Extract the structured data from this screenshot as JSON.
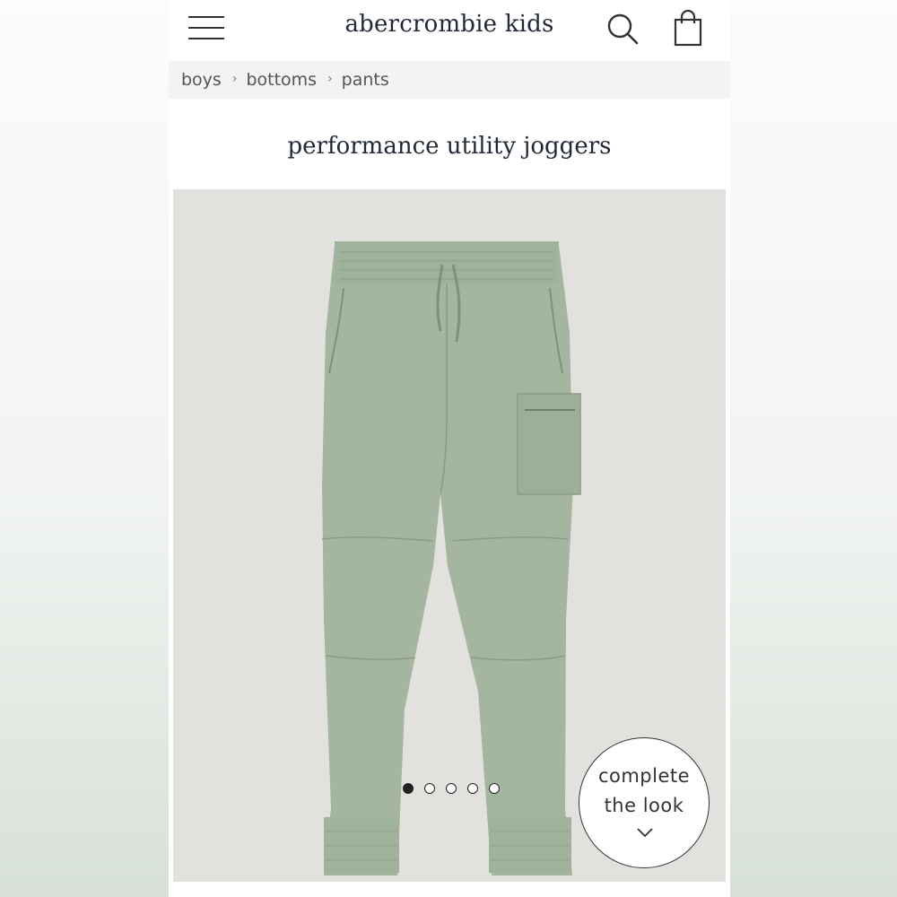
{
  "header": {
    "brand": "abercrombie kids",
    "menu_icon": "hamburger-menu-icon",
    "search_icon": "search-icon",
    "bag_icon": "shopping-bag-icon"
  },
  "breadcrumb": [
    "boys",
    "bottoms",
    "pants"
  ],
  "product": {
    "title": "performance utility joggers",
    "image_count": 5,
    "active_image": 1,
    "color": "#a4b6a0"
  },
  "complete_the_look": {
    "line1": "complete",
    "line2": "the look"
  }
}
